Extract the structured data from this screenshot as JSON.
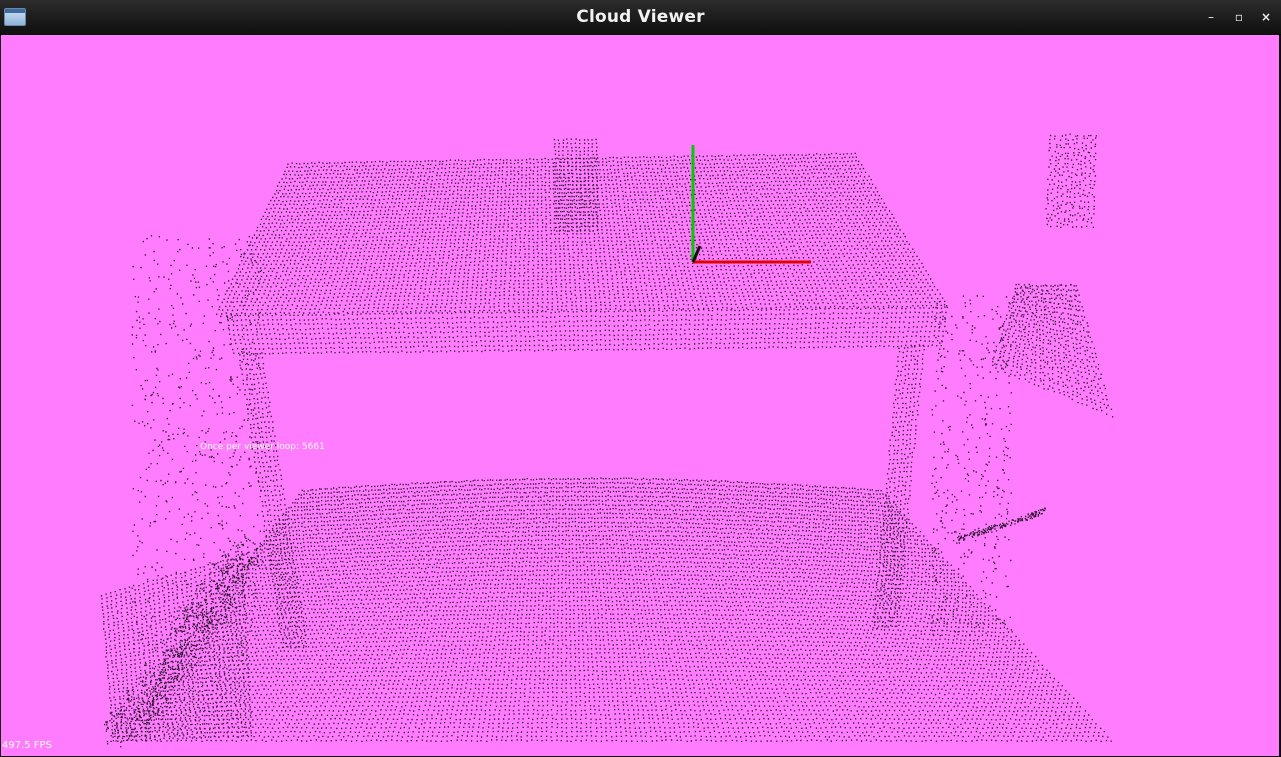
{
  "window": {
    "title": "Cloud Viewer",
    "icon": "window-app-icon",
    "controls": {
      "minimize": "–",
      "maximize": "▫",
      "close": "×"
    }
  },
  "viewer": {
    "background_color": "#ff7cff",
    "point_color": "#000000",
    "overlay_text": "Once per viewer loop: 5661",
    "fps_text": "497.5 FPS",
    "axes": {
      "x_color": "#e00000",
      "y_color": "#00cc00",
      "z_color": "#101010"
    }
  }
}
